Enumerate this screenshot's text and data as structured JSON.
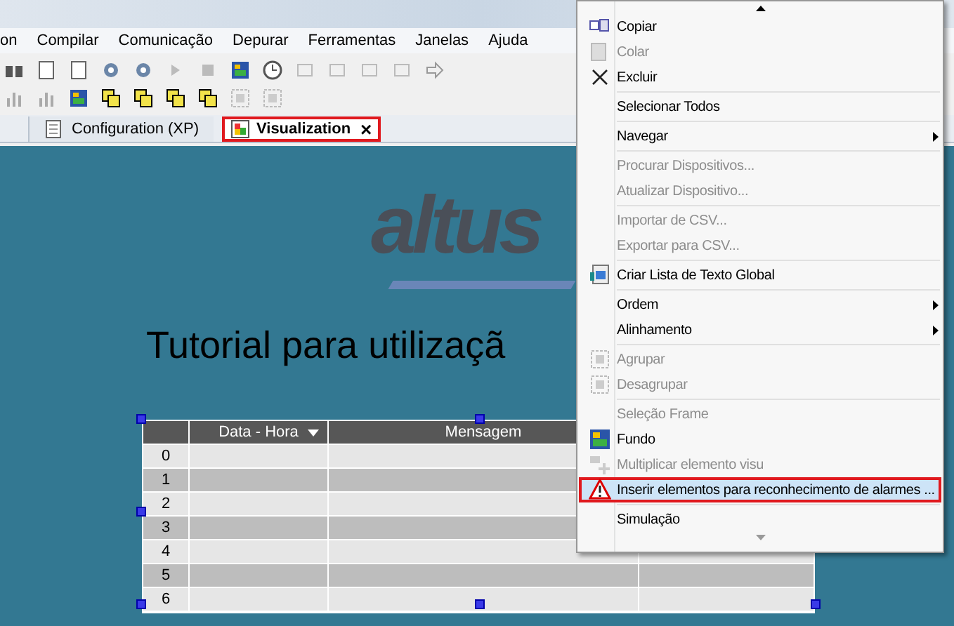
{
  "menubar": [
    "on",
    "Compilar",
    "Comunicação",
    "Depurar",
    "Ferramentas",
    "Janelas",
    "Ajuda"
  ],
  "tabs": [
    {
      "label": "Configuration (XP)",
      "selected": false
    },
    {
      "label": "Visualization",
      "selected": true,
      "close": "×"
    }
  ],
  "canvas": {
    "logo": "altus",
    "heading": "Tutorial para utilizaçã",
    "table": {
      "columns": [
        "Data - Hora",
        "Mensagem"
      ],
      "rows": [
        "0",
        "1",
        "2",
        "3",
        "4",
        "5",
        "6"
      ]
    }
  },
  "context_menu": {
    "items": [
      {
        "kind": "item",
        "label": "Copiar",
        "disabled": false,
        "submenu": false,
        "selected": false
      },
      {
        "kind": "item",
        "label": "Colar",
        "disabled": true,
        "submenu": false,
        "selected": false
      },
      {
        "kind": "item",
        "label": "Excluir",
        "disabled": false,
        "submenu": false,
        "selected": false
      },
      {
        "kind": "separator"
      },
      {
        "kind": "item",
        "label": "Selecionar Todos",
        "disabled": false,
        "submenu": false,
        "selected": false
      },
      {
        "kind": "separator"
      },
      {
        "kind": "item",
        "label": "Navegar",
        "disabled": false,
        "submenu": true,
        "selected": false
      },
      {
        "kind": "separator"
      },
      {
        "kind": "item",
        "label": "Procurar Dispositivos...",
        "disabled": true,
        "submenu": false,
        "selected": false
      },
      {
        "kind": "item",
        "label": "Atualizar Dispositivo...",
        "disabled": true,
        "submenu": false,
        "selected": false
      },
      {
        "kind": "separator"
      },
      {
        "kind": "item",
        "label": "Importar de CSV...",
        "disabled": true,
        "submenu": false,
        "selected": false
      },
      {
        "kind": "item",
        "label": "Exportar para CSV...",
        "disabled": true,
        "submenu": false,
        "selected": false
      },
      {
        "kind": "separator"
      },
      {
        "kind": "item",
        "label": "Criar Lista de Texto Global",
        "disabled": false,
        "submenu": false,
        "selected": false
      },
      {
        "kind": "separator"
      },
      {
        "kind": "item",
        "label": "Ordem",
        "disabled": false,
        "submenu": true,
        "selected": false
      },
      {
        "kind": "item",
        "label": "Alinhamento",
        "disabled": false,
        "submenu": true,
        "selected": false
      },
      {
        "kind": "separator"
      },
      {
        "kind": "item",
        "label": "Agrupar",
        "disabled": true,
        "submenu": false,
        "selected": false
      },
      {
        "kind": "item",
        "label": "Desagrupar",
        "disabled": true,
        "submenu": false,
        "selected": false
      },
      {
        "kind": "separator"
      },
      {
        "kind": "item",
        "label": "Seleção Frame",
        "disabled": true,
        "submenu": false,
        "selected": false
      },
      {
        "kind": "item",
        "label": "Fundo",
        "disabled": false,
        "submenu": false,
        "selected": false
      },
      {
        "kind": "item",
        "label": "Multiplicar elemento visu",
        "disabled": true,
        "submenu": false,
        "selected": false
      },
      {
        "kind": "item",
        "label": "Inserir elementos para reconhecimento de alarmes ...",
        "disabled": false,
        "submenu": false,
        "selected": true
      },
      {
        "kind": "separator"
      },
      {
        "kind": "item",
        "label": "Simulação",
        "disabled": false,
        "submenu": false,
        "selected": false
      }
    ]
  }
}
